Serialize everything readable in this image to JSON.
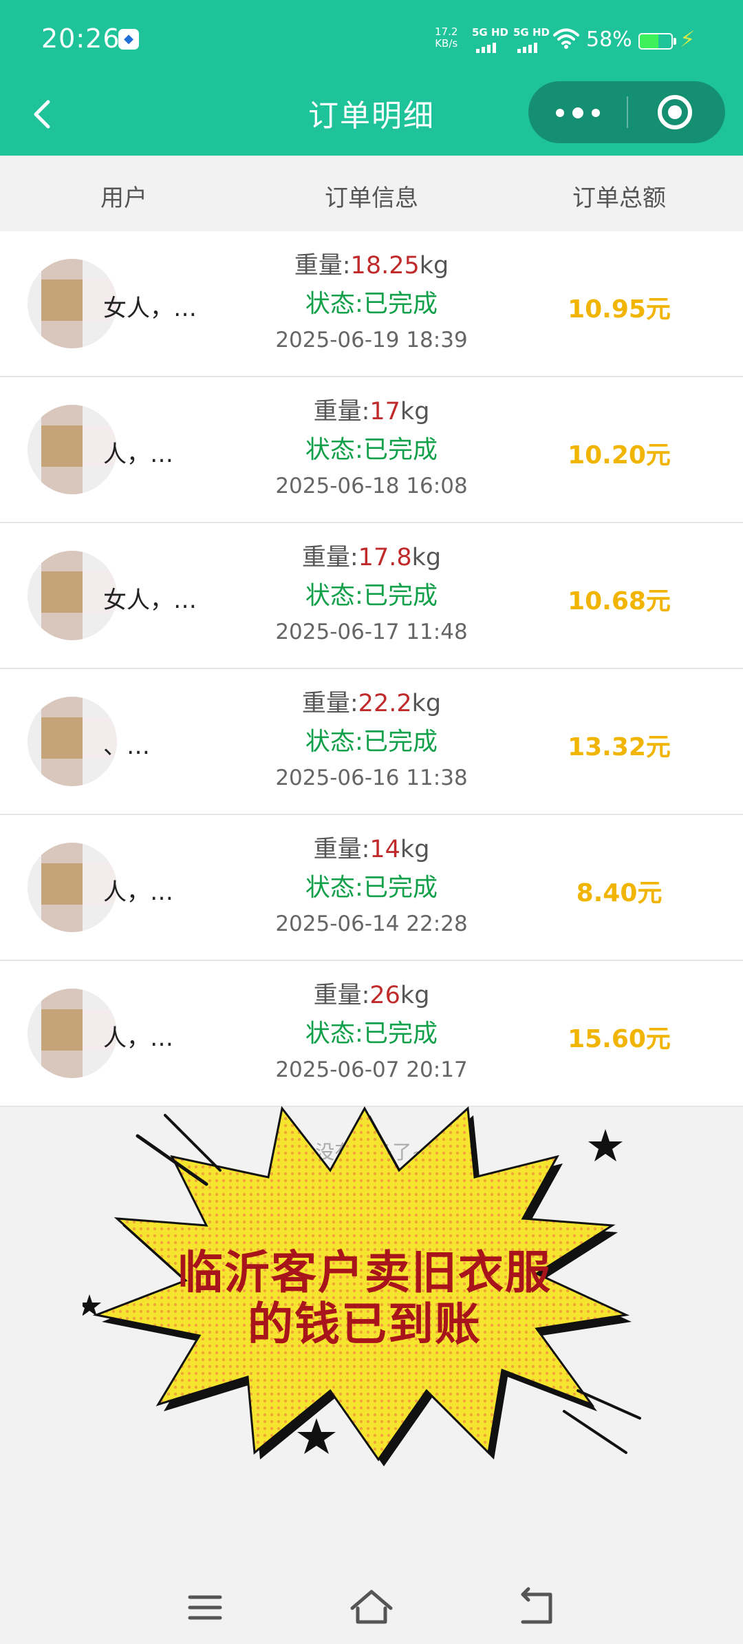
{
  "status_bar": {
    "time": "20:26",
    "net_speed_value": "17.2",
    "net_speed_unit": "KB/s",
    "signal_1": "5G HD",
    "signal_2": "5G HD",
    "battery": "58%",
    "battery_level": 0.58
  },
  "nav": {
    "title": "订单明细",
    "back_icon": "chevron-left-icon",
    "more_icon": "more-dots-icon",
    "close_icon": "target-circle-icon"
  },
  "table_header": {
    "user": "用户",
    "info": "订单信息",
    "total": "订单总额"
  },
  "labels": {
    "weight_prefix": "重量:",
    "weight_unit": "kg"
  },
  "orders": [
    {
      "user": "女人，…",
      "weight": "18.25",
      "status": "状态:已完成",
      "date": "2025-06-19 18:39",
      "amount": "10.95元"
    },
    {
      "user": "人，…",
      "weight": "17",
      "status": "状态:已完成",
      "date": "2025-06-18 16:08",
      "amount": "10.20元"
    },
    {
      "user": "女人，…",
      "weight": "17.8",
      "status": "状态:已完成",
      "date": "2025-06-17 11:48",
      "amount": "10.68元"
    },
    {
      "user": "、…",
      "weight": "22.2",
      "status": "状态:已完成",
      "date": "2025-06-16 11:38",
      "amount": "13.32元"
    },
    {
      "user": "人，…",
      "weight": "14",
      "status": "状态:已完成",
      "date": "2025-06-14 22:28",
      "amount": "8.40元"
    },
    {
      "user": "人，…",
      "weight": "26",
      "status": "状态:已完成",
      "date": "2025-06-07 20:17",
      "amount": "15.60元"
    }
  ],
  "footer": {
    "no_more": "没有更多了~"
  },
  "overlay": {
    "line1": "临沂客户卖旧衣服",
    "line2": "的钱已到账",
    "text_color": "#a8141b",
    "burst_color": "#f6e52e"
  },
  "colors": {
    "header_green": "#1ec39a",
    "weight_red": "#c02a2a",
    "status_green": "#13a04a",
    "amount_yellow": "#f1b400"
  },
  "system_nav": {
    "menu_icon": "menu-icon",
    "home_icon": "home-icon",
    "back_icon": "back-arrow-icon"
  }
}
